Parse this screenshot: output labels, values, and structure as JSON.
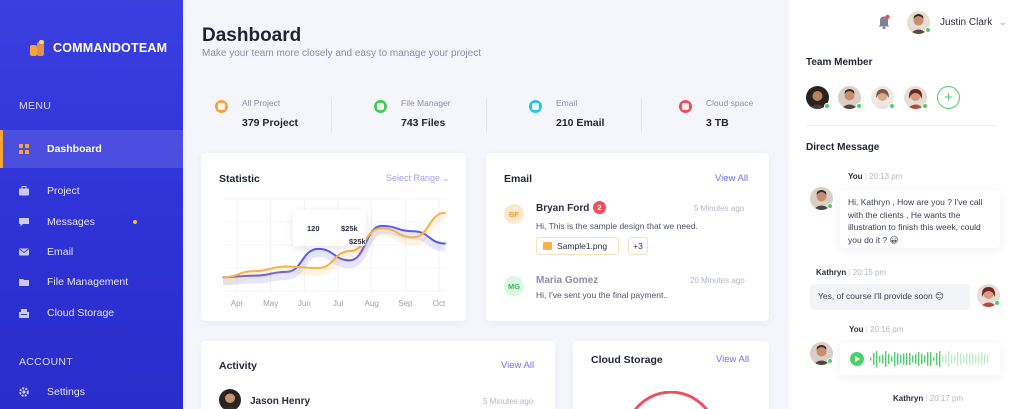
{
  "brand": {
    "name": "COMMANDOTEAM"
  },
  "sidebar": {
    "menu_label": "MENU",
    "account_label": "ACCOUNT",
    "items": [
      {
        "label": "Dashboard",
        "icon": "grid-icon"
      },
      {
        "label": "Project",
        "icon": "briefcase-icon"
      },
      {
        "label": "Messages",
        "icon": "chat-icon"
      },
      {
        "label": "Email",
        "icon": "mail-icon"
      },
      {
        "label": "File Management",
        "icon": "folder-icon"
      },
      {
        "label": "Cloud Storage",
        "icon": "cloud-icon"
      }
    ],
    "account_items": [
      {
        "label": "Settings",
        "icon": "gear-icon"
      }
    ]
  },
  "header": {
    "title": "Dashboard",
    "subtitle": "Make your team more closely and easy to manage your project"
  },
  "stats": [
    {
      "label": "All Project",
      "value": "379 Project",
      "color": "#f6a23c"
    },
    {
      "label": "File Manager",
      "value": "743 Files",
      "color": "#49c95b"
    },
    {
      "label": "Email",
      "value": "210 Email",
      "color": "#25c3e6"
    },
    {
      "label": "Cloud space",
      "value": "3 TB",
      "color": "#ee4c5a"
    }
  ],
  "statistic": {
    "title": "Statistic",
    "range_label": "Select Range",
    "tooltip": {
      "project": "120",
      "revenue": "$25k",
      "total": "$25k"
    }
  },
  "chart_data": {
    "type": "line",
    "title": "Statistic",
    "categories": [
      "Apr",
      "May",
      "Jun",
      "Jul",
      "Aug",
      "Sep",
      "Oct"
    ],
    "series": [
      {
        "color": "#5a5be8",
        "values": [
          18,
          20,
          25,
          55,
          40,
          85,
          78,
          62
        ]
      },
      {
        "color": "#f6b24a",
        "values": [
          18,
          26,
          32,
          30,
          52,
          82,
          70,
          102
        ]
      }
    ],
    "ylim": [
      0,
      120
    ]
  },
  "email": {
    "title": "Email",
    "view_all": "View All",
    "messages": [
      {
        "initials": "BF",
        "name": "Bryan Ford",
        "count": "2",
        "time": "5 Minutes ago",
        "text": "Hi, This is the sample design that we need.",
        "attachment": "Sample1.png",
        "more": "+3"
      },
      {
        "initials": "MG",
        "name": "Maria Gomez",
        "time": "20 Minutes ago",
        "text": "Hi, I've sent you the final payment.."
      }
    ]
  },
  "activity": {
    "title": "Activity",
    "view_all": "View All",
    "items": [
      {
        "name": "Jason Henry",
        "time": "5 Minutes ago"
      }
    ]
  },
  "cloud": {
    "title": "Cloud Storage",
    "view_all": "View All"
  },
  "user": {
    "name": "Justin Clark"
  },
  "team": {
    "title": "Team Member"
  },
  "dm": {
    "title": "Direct Message",
    "messages": [
      {
        "sender": "You",
        "time": "20:13 pm",
        "text": "Hi, Kathryn , How are you ? I've call with the clients , He wants the illustration to finish this week, could you do it ? 😀"
      },
      {
        "sender": "Kathryn",
        "time": "20:15 pm",
        "text": "Yes, of course I'll provide soon 😊"
      },
      {
        "sender": "You",
        "time": "20:16 pm"
      },
      {
        "sender": "Kathryn",
        "time": "20:17 pm"
      }
    ]
  }
}
